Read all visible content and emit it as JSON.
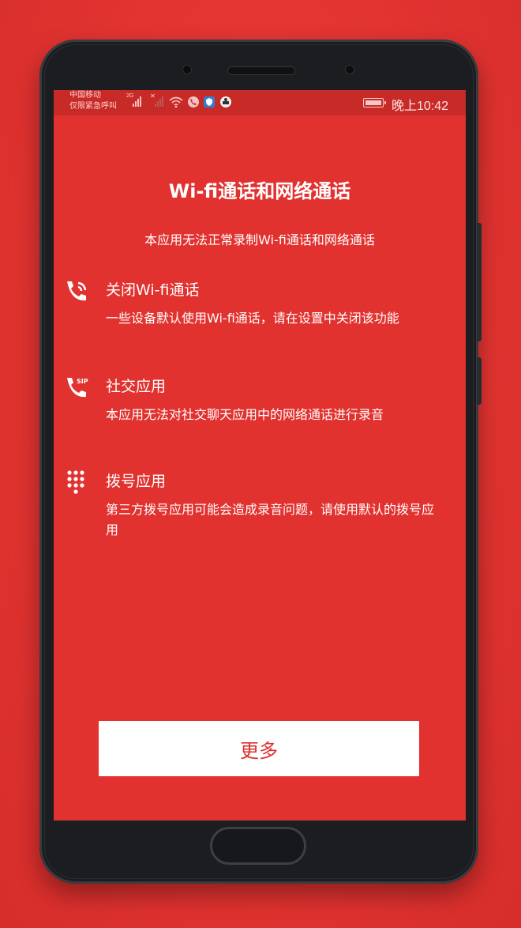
{
  "status_bar": {
    "carrier_line1": "中国移动",
    "carrier_line2": "仅限紧急呼叫",
    "network_tag": "2G",
    "no_sim_tag": "✕",
    "time": "晚上10:42",
    "icons": [
      "signal-icon",
      "signal-empty-icon",
      "wifi-icon",
      "call-recorder-icon",
      "shield-icon",
      "app-icon",
      "battery-icon"
    ]
  },
  "dialog": {
    "title": "Wi-fi通话和网络通话",
    "subtitle": "本应用无法正常录制Wi-fi通话和网络通话",
    "items": [
      {
        "icon": "wifi-call-icon",
        "heading": "关闭Wi-fi通话",
        "description": "一些设备默认使用Wi-fi通话，请在设置中关闭该功能"
      },
      {
        "icon": "sip-phone-icon",
        "heading": "社交应用",
        "description": "本应用无法对社交聊天应用中的网络通话进行录音"
      },
      {
        "icon": "dialpad-icon",
        "heading": "拨号应用",
        "description": "第三方拨号应用可能会造成录音问题，请使用默认的拨号应用"
      }
    ],
    "button_label": "更多"
  },
  "colors": {
    "background": "#e1322f",
    "status_bar": "#c82a28",
    "button_text": "#d9302d"
  }
}
